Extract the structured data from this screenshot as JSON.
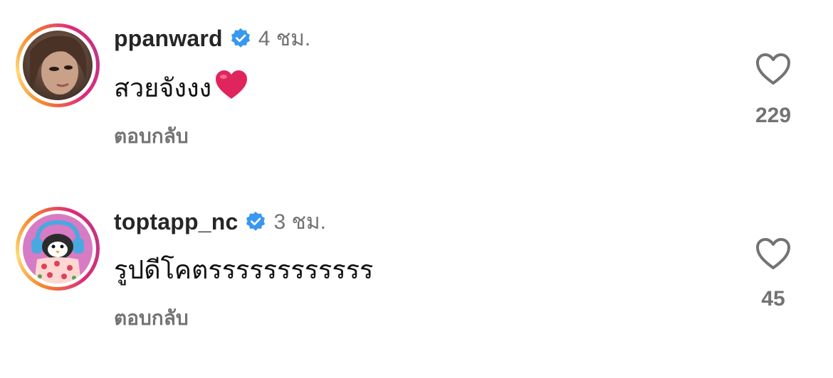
{
  "comments": [
    {
      "username": "ppanward",
      "time": "4 ชม.",
      "text": "สวยจังงง",
      "reply_label": "ตอบกลับ",
      "like_count": "229",
      "verified": true
    },
    {
      "username": "toptapp_nc",
      "time": "3 ชม.",
      "text": "รูปดีโคตรรรรรรรรรรรร",
      "reply_label": "ตอบกลับ",
      "like_count": "45",
      "verified": true
    }
  ],
  "colors": {
    "verified_badge": "#3897f0",
    "secondary_text": "#737373",
    "primary_text": "#262626",
    "heart_emoji": "#e0245e"
  },
  "icons": {
    "verified": "verified-badge-icon",
    "like": "heart-outline-icon",
    "emoji": "red-heart-emoji"
  }
}
